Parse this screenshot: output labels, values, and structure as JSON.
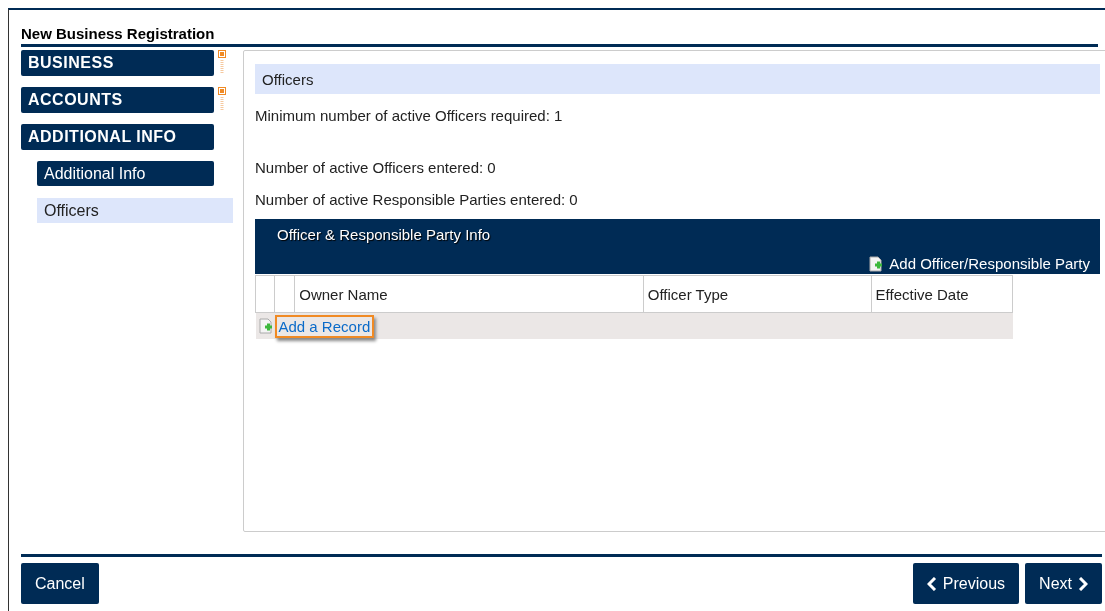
{
  "window": {
    "title": "New Business Registration"
  },
  "sidebar": {
    "items": [
      {
        "kind": "section",
        "label": "BUSINESS",
        "collapsed": true,
        "selected": false
      },
      {
        "kind": "section",
        "label": "ACCOUNTS",
        "collapsed": true,
        "selected": false
      },
      {
        "kind": "section",
        "label": "ADDITIONAL INFO",
        "collapsed": false,
        "selected": false
      },
      {
        "kind": "sub",
        "label": "Additional Info",
        "selected": false
      },
      {
        "kind": "sub",
        "label": "Officers",
        "selected": true
      }
    ]
  },
  "content": {
    "heading": "Officers",
    "requirement": "Minimum number of active Officers required: 1",
    "counts": [
      "Number of active Officers entered: 0",
      "Number of active Responsible Parties entered: 0"
    ],
    "section": {
      "title": "Officer & Responsible Party Info",
      "add_link": "Add Officer/Responsible Party"
    },
    "table": {
      "columns": [
        "Owner Name",
        "Officer Type",
        "Effective Date"
      ],
      "add_record": {
        "label": "Add a Record",
        "highlighted": true
      }
    }
  },
  "footer": {
    "buttons": [
      {
        "label": "Cancel",
        "kind": "cancel"
      },
      {
        "label": "Previous",
        "kind": "previous"
      },
      {
        "label": "Next",
        "kind": "next"
      }
    ]
  }
}
